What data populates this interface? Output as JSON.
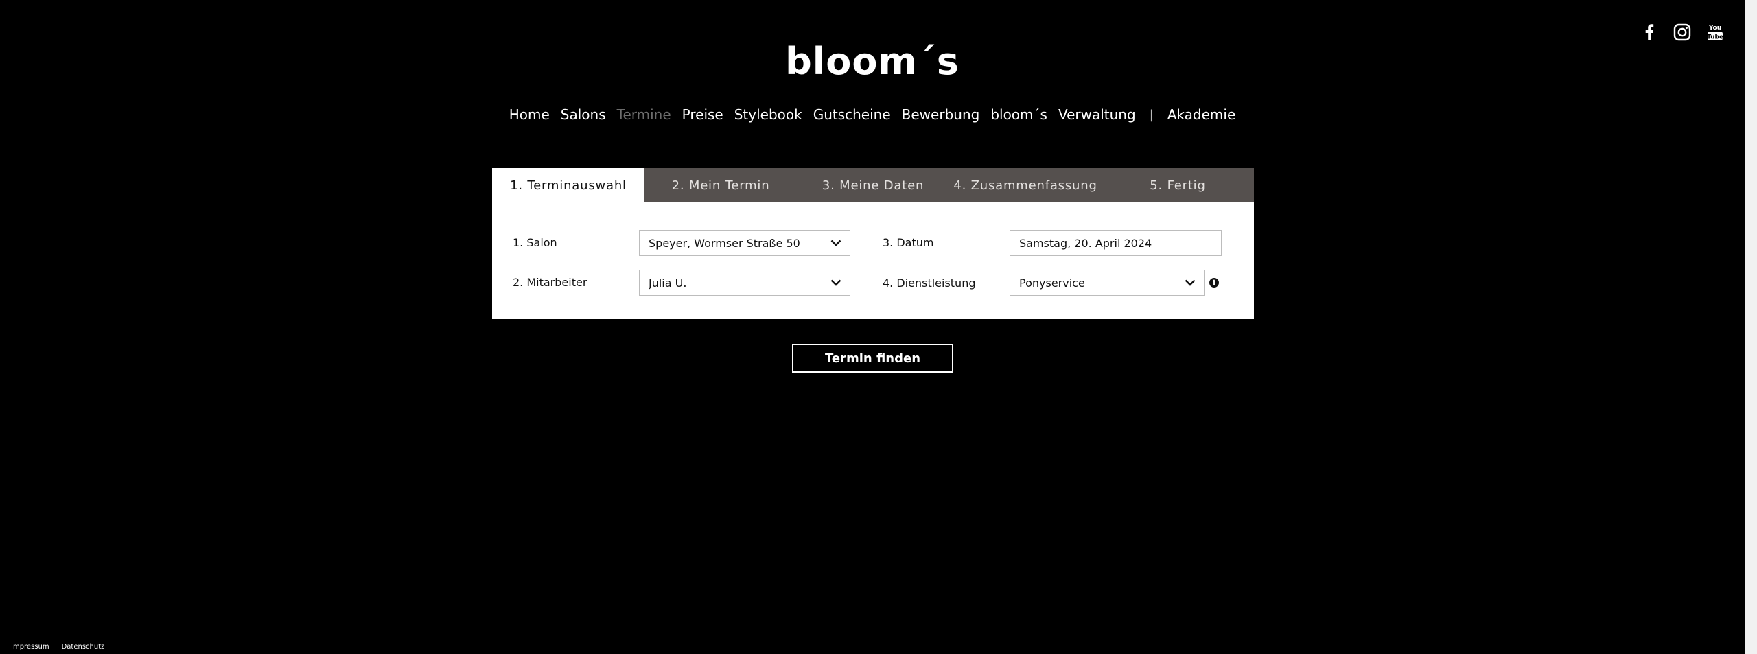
{
  "brand": {
    "logo_text": "bloom´s"
  },
  "social": [
    {
      "icon": "facebook-icon"
    },
    {
      "icon": "instagram-icon"
    },
    {
      "icon": "youtube-icon"
    }
  ],
  "nav": {
    "items": [
      {
        "label": "Home",
        "active": false
      },
      {
        "label": "Salons",
        "active": false
      },
      {
        "label": "Termine",
        "active": true
      },
      {
        "label": "Preise",
        "active": false
      },
      {
        "label": "Stylebook",
        "active": false
      },
      {
        "label": "Gutscheine",
        "active": false
      },
      {
        "label": "Bewerbung",
        "active": false
      },
      {
        "label": "bloom´s",
        "active": false
      },
      {
        "label": "Verwaltung",
        "active": false
      }
    ],
    "separator": "|",
    "extra_item": "Akademie"
  },
  "steps": [
    {
      "label": "1. Terminauswahl"
    },
    {
      "label": "2. Mein Termin"
    },
    {
      "label": "3. Meine Daten"
    },
    {
      "label": "4. Zusammenfassung"
    },
    {
      "label": "5. Fertig"
    }
  ],
  "form": {
    "salon": {
      "label": "1. Salon",
      "value": "Speyer, Wormser Straße 50"
    },
    "mitarbeiter": {
      "label": "2. Mitarbeiter",
      "value": "Julia U."
    },
    "datum": {
      "label": "3. Datum",
      "value": "Samstag, 20. April 2024"
    },
    "dienstleistung": {
      "label": "4. Dienstleistung",
      "value": "Ponyservice",
      "info_icon": "info-icon"
    }
  },
  "cta": {
    "label": "Termin finden"
  },
  "footer": {
    "impressum": "Impressum",
    "datenschutz": "Datenschutz"
  },
  "colors": {
    "background": "#000000",
    "tab_bar": "#55504e",
    "nav_active": "#6d6d6d",
    "panel": "#ffffff"
  }
}
